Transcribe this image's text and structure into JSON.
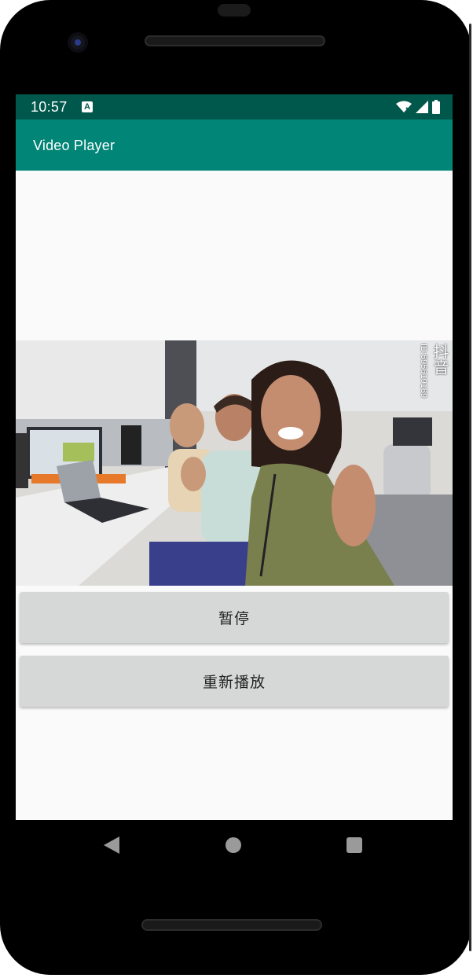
{
  "status_bar": {
    "time": "10:57",
    "notification_icon": "a-icon",
    "icons": [
      "wifi-icon",
      "signal-icon",
      "battery-icon"
    ]
  },
  "app_bar": {
    "title": "Video Player"
  },
  "video": {
    "watermark_app": "抖音",
    "watermark_id": "ID:595619189"
  },
  "buttons": {
    "pause_label": "暂停",
    "replay_label": "重新播放"
  },
  "nav_bar": {
    "icons": [
      "back-icon",
      "home-icon",
      "recents-icon"
    ]
  },
  "colors": {
    "status_bar": "#00574b",
    "app_bar": "#008577",
    "button": "#d6d7d7",
    "screen_bg": "#fafafa"
  }
}
